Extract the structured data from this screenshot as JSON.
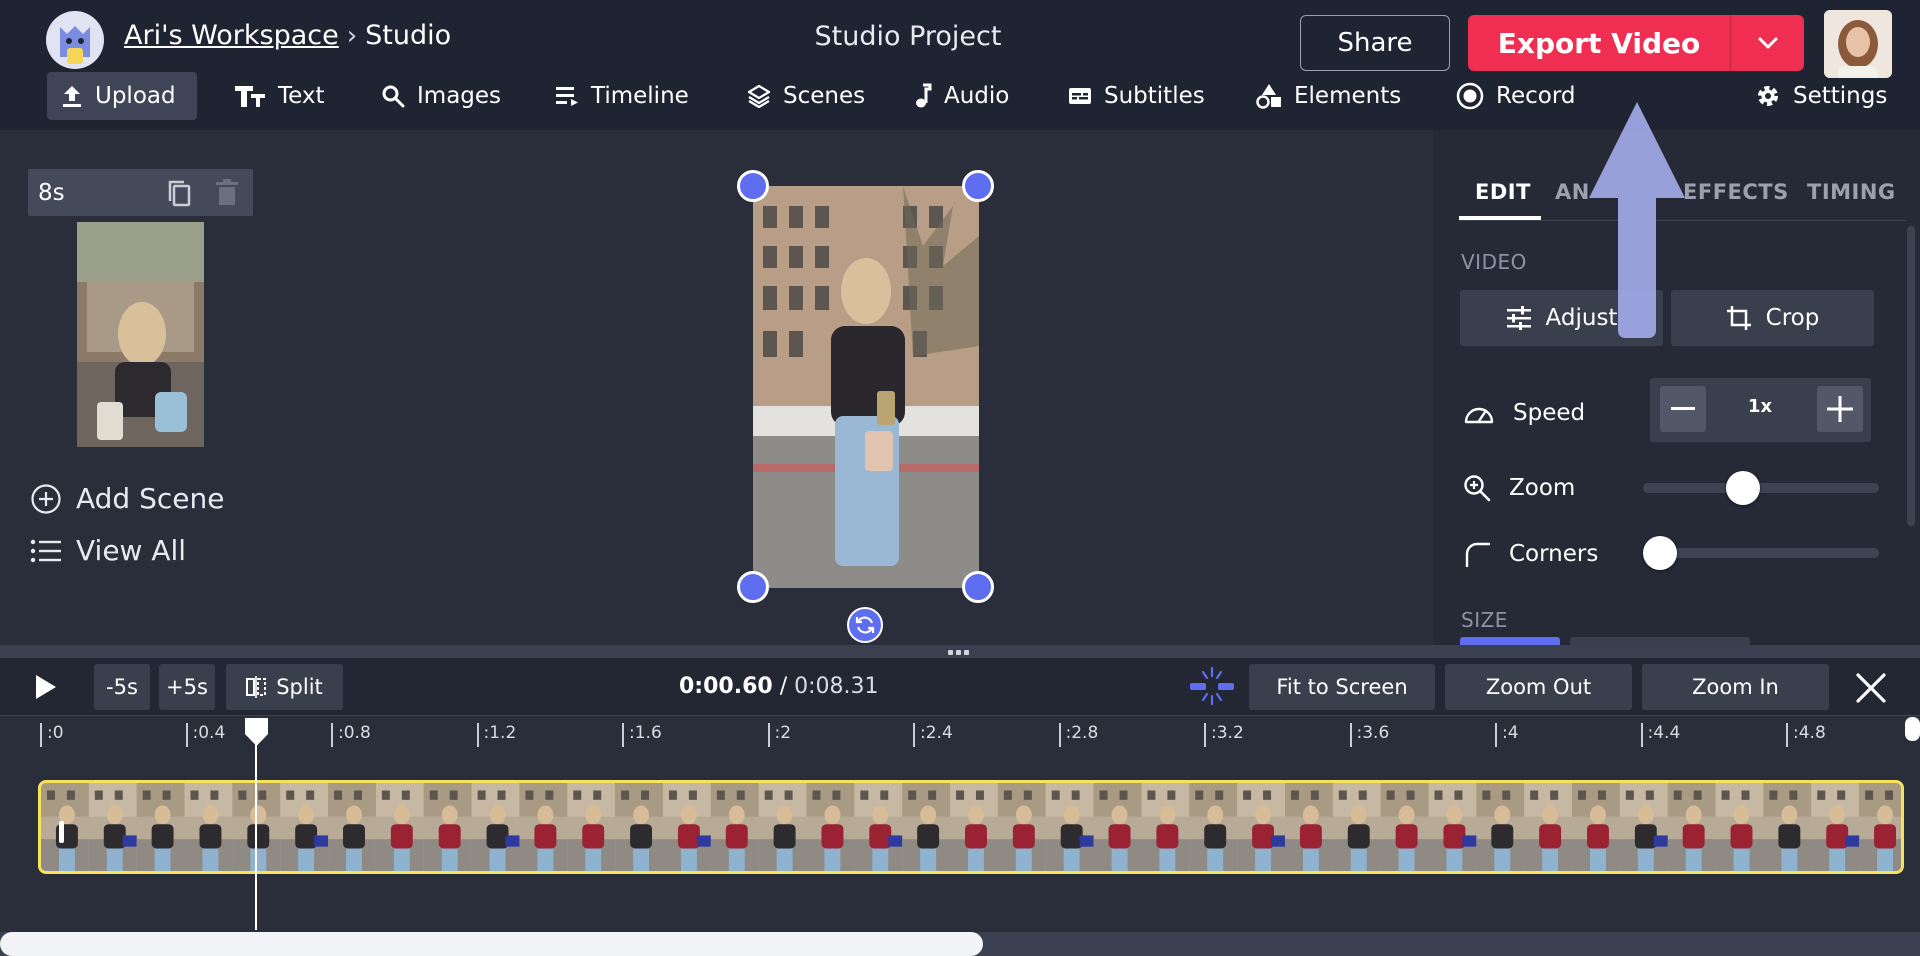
{
  "header": {
    "workspace": "Ari's Workspace",
    "separator": "›",
    "location": "Studio",
    "project_title": "Studio Project",
    "share_label": "Share",
    "export_label": "Export Video",
    "export_color": "#ef2e52"
  },
  "toolbar": {
    "items": [
      {
        "label": "Upload",
        "icon": "upload-icon",
        "active": true
      },
      {
        "label": "Text",
        "icon": "text-icon"
      },
      {
        "label": "Images",
        "icon": "search-icon"
      },
      {
        "label": "Timeline",
        "icon": "timeline-icon"
      },
      {
        "label": "Scenes",
        "icon": "layers-icon"
      },
      {
        "label": "Audio",
        "icon": "music-note-icon"
      },
      {
        "label": "Subtitles",
        "icon": "subtitles-icon"
      },
      {
        "label": "Elements",
        "icon": "shapes-icon"
      },
      {
        "label": "Record",
        "icon": "record-icon"
      }
    ],
    "settings_label": "Settings"
  },
  "scenes": {
    "duration": "8s",
    "add_scene": "Add Scene",
    "view_all": "View All"
  },
  "panel": {
    "tabs": [
      "EDIT",
      "AN",
      "EFFECTS",
      "TIMING"
    ],
    "active_tab": "EDIT",
    "video_section": "VIDEO",
    "adjust_label": "Adjust",
    "crop_label": "Crop",
    "speed_label": "Speed",
    "speed_value": "1x",
    "zoom_label": "Zoom",
    "zoom_level": 0.41,
    "corners_label": "Corners",
    "corners_level": 0,
    "size_section": "SIZE"
  },
  "timeline": {
    "back_label": "-5s",
    "forward_label": "+5s",
    "split_label": "Split",
    "current_time": "0:00.60",
    "time_separator": " / ",
    "total_time": "0:08.31",
    "fit_label": "Fit to Screen",
    "zoom_out_label": "Zoom Out",
    "zoom_in_label": "Zoom In",
    "ticks": [
      ":0",
      ":0.4",
      ":0.8",
      ":1.2",
      ":1.6",
      ":2",
      ":2.4",
      ":2.8",
      ":3.2",
      ":3.6",
      ":4",
      ":4.4",
      ":4.8"
    ],
    "track_highlight": "#f6e35a"
  },
  "accent": "#5f6ef0"
}
